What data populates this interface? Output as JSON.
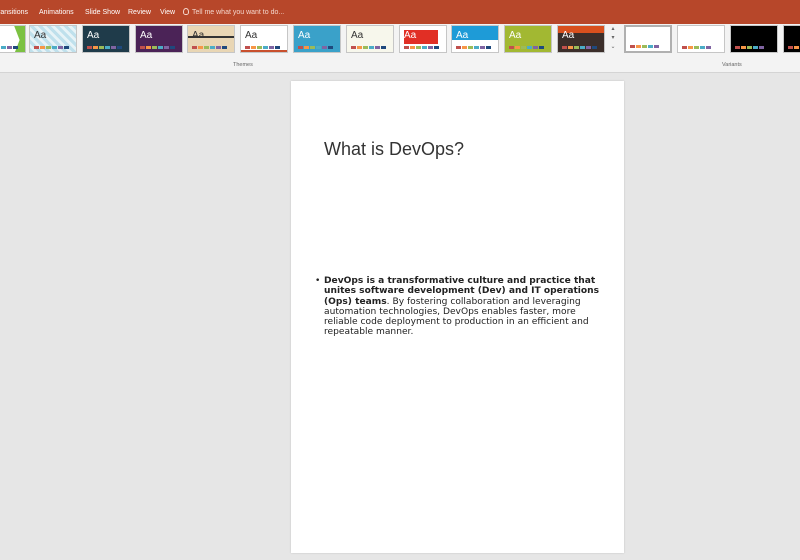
{
  "tabs": [
    {
      "label": "Transitions"
    },
    {
      "label": "Animations"
    },
    {
      "label": "Slide Show"
    },
    {
      "label": "Review"
    },
    {
      "label": "View"
    }
  ],
  "tell_me": {
    "text": "Tell me what you want to do..."
  },
  "groups": {
    "themes_label": "Themes",
    "variants_label": "Variants"
  },
  "themes": [
    {
      "aa": "",
      "bg": "#ffffff",
      "accent": "#7cc142",
      "text_color": "#333333"
    },
    {
      "aa": "Aa",
      "bg": "#e7f3f7",
      "accent": "#3aa1c9",
      "text_color": "#333333"
    },
    {
      "aa": "Aa",
      "bg": "#1f3b4a",
      "accent": "#2e6f6b",
      "text_color": "#ffffff"
    },
    {
      "aa": "Aa",
      "bg": "#4b2357",
      "accent": "#8b3e7d",
      "text_color": "#ffffff"
    },
    {
      "aa": "Aa",
      "bg": "#e9d6b4",
      "accent": "#c49a5c",
      "text_color": "#333333"
    },
    {
      "aa": "Aa",
      "bg": "#ffffff",
      "accent": "#c9502d",
      "text_color": "#333333"
    },
    {
      "aa": "Aa",
      "bg": "#3aa1c9",
      "accent": "#2a7ea3",
      "text_color": "#ffffff"
    },
    {
      "aa": "Aa",
      "bg": "#f7f7ec",
      "accent": "#9bbb59",
      "text_color": "#333333"
    },
    {
      "aa": "Aa",
      "bg": "#ffffff",
      "accent": "#e12f25",
      "text_color": "#ffffff"
    },
    {
      "aa": "Aa",
      "bg": "#ffffff",
      "accent": "#1e9bd7",
      "text_color": "#ffffff"
    },
    {
      "aa": "Aa",
      "bg": "#a2b832",
      "accent": "#8aa12a",
      "text_color": "#ffffff"
    },
    {
      "aa": "Aa",
      "bg": "#3b2e2a",
      "accent": "#d8501e",
      "text_color": "#ffffff"
    }
  ],
  "variants": [
    {
      "bg": "#ffffff"
    },
    {
      "bg": "#ffffff"
    },
    {
      "bg": "#000000"
    },
    {
      "bg": "#000000"
    }
  ],
  "slide": {
    "title": "What is DevOps?",
    "bullet_bold": "DevOps is a transformative culture and practice that unites software development (Dev) and IT operations (Ops) teams",
    "bullet_rest": ". By fostering collaboration and leveraging automation technologies, DevOps enables faster, more reliable code deployment to production in an efficient and repeatable manner."
  },
  "colors": {
    "ribbon_accent": "#b7472a"
  }
}
